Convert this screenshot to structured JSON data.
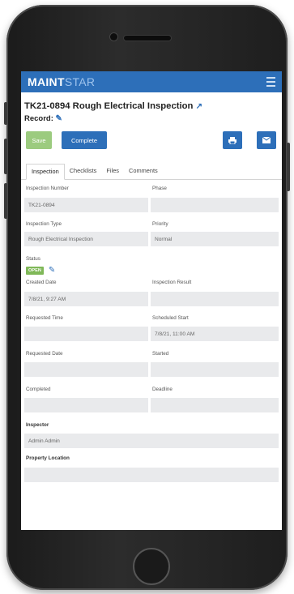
{
  "app": {
    "logo_bold": "MAINT",
    "logo_thin": "STAR"
  },
  "header": {
    "title": "TK21-0894 Rough Electrical Inspection",
    "record_label": "Record:"
  },
  "toolbar": {
    "save_label": "Save",
    "complete_label": "Complete"
  },
  "tabs": [
    {
      "label": "Inspection"
    },
    {
      "label": "Checklists"
    },
    {
      "label": "Files"
    },
    {
      "label": "Comments"
    }
  ],
  "form": {
    "inspection_number": {
      "label": "Inspection Number",
      "value": "TK21-0894"
    },
    "phase": {
      "label": "Phase",
      "value": ""
    },
    "inspection_type": {
      "label": "Inspection Type",
      "value": "Rough Electrical Inspection"
    },
    "priority": {
      "label": "Priority",
      "value": "Normal"
    },
    "status": {
      "label": "Status",
      "value": "OPEN"
    },
    "created_date": {
      "label": "Created Date",
      "value": "7/8/21, 9:27 AM"
    },
    "inspection_result": {
      "label": "Inspection Result",
      "value": ""
    },
    "requested_time": {
      "label": "Requested Time",
      "value": ""
    },
    "scheduled_start": {
      "label": "Scheduled Start",
      "value": "7/8/21, 11:00 AM"
    },
    "requested_date": {
      "label": "Requested Date",
      "value": ""
    },
    "started": {
      "label": "Started",
      "value": ""
    },
    "completed": {
      "label": "Completed",
      "value": ""
    },
    "deadline": {
      "label": "Deadline",
      "value": ""
    },
    "inspector": {
      "label": "Inspector",
      "value": "Admin Admin"
    },
    "property_location": {
      "label": "Property Location",
      "value": ""
    }
  },
  "colors": {
    "brand": "#2d6fb9",
    "save_disabled": "#9ccb7f",
    "status_open": "#7fb858"
  }
}
